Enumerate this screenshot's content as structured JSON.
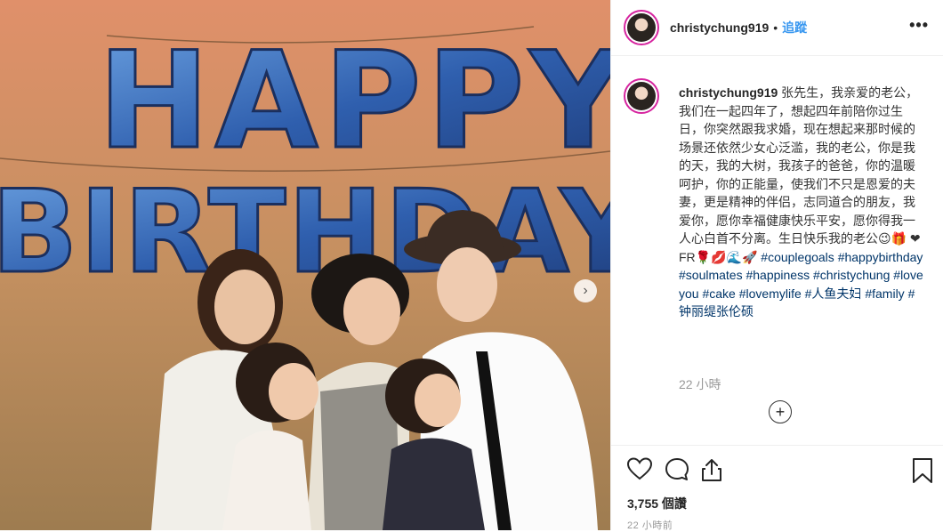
{
  "post": {
    "username": "christychung919",
    "follow_label": "追蹤",
    "separator": "•",
    "more_label": "•••",
    "balloon_letters": [
      "HAPPY",
      "BIRTHDAY"
    ],
    "caption_username": "christychung919",
    "caption_text": "张先生，我亲爱的老公，我们在一起四年了，想起四年前陪你过生日，你突然跟我求婚，现在想起来那时候的场景还依然少女心泛滥，我的老公，你是我的天，我的大树，我孩子的爸爸，你的温暖呵护，你的正能量，使我们不只是恩爱的夫妻，更是精神的伴侣，志同道合的朋友，我爱你，愿你幸福健康快乐平安，愿你得我一人心白首不分离。生日快乐我的老公😉🎁",
    "caption_emoji_line": "❤FR🌹💋🌊🚀",
    "hashtags": [
      "#couplegoals",
      "#happybirthday",
      "#soulmates",
      "#happiness",
      "#christychung",
      "#loveyou",
      "#cake",
      "#lovemylife",
      "#人鱼夫妇",
      "#family",
      "#钟丽缇张伦硕"
    ],
    "time_ago": "22 小時",
    "add_comment_icon": "+",
    "views": "3,755 個讚",
    "posted_ago": "22 小時前",
    "next_icon": "›"
  },
  "colors": {
    "link": "#003569",
    "follow": "#3897f0",
    "story_ring": "#d6249f",
    "muted": "#999999"
  },
  "icons": [
    "heart-icon",
    "comment-icon",
    "share-icon",
    "bookmark-icon",
    "add-comment-icon",
    "more-icon",
    "next-image-icon"
  ]
}
